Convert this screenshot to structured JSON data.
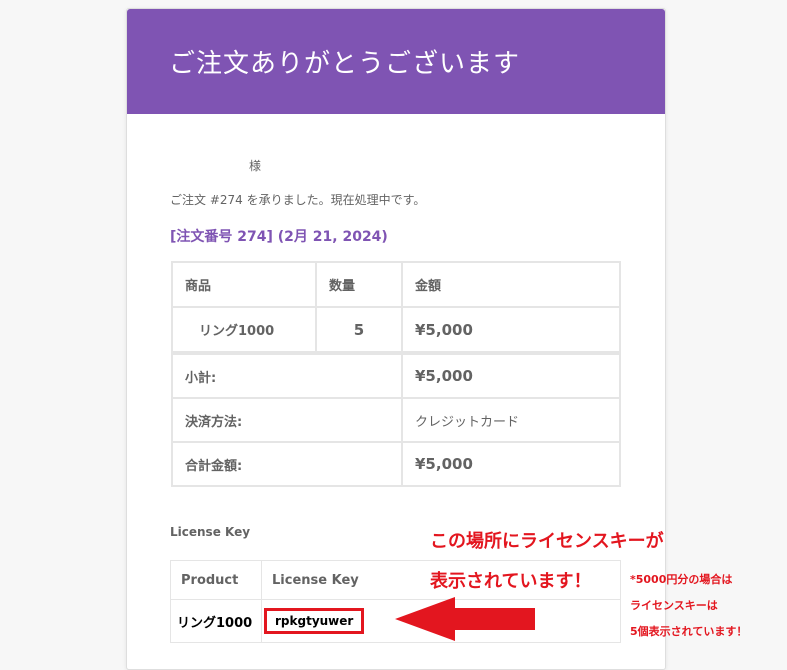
{
  "email": {
    "title": "ご注文ありがとうございます",
    "salutation": "様",
    "intro": "ご注文 #274 を承りました。現在処理中です。",
    "order_heading": "[注文番号 274] (2月 21, 2024)",
    "brand_color": "#7f54b3"
  },
  "order_table": {
    "headers": [
      "商品",
      "数量",
      "金額"
    ],
    "item": {
      "name": "リング1000",
      "qty": "5",
      "price": "¥5,000"
    },
    "totals": [
      {
        "label": "小計:",
        "value": "¥5,000"
      },
      {
        "label": "決済方法:",
        "value": "クレジットカード"
      },
      {
        "label": "合計金額:",
        "value": "¥5,000"
      }
    ]
  },
  "license": {
    "section_title": "License Key",
    "headers": [
      "Product",
      "License Key"
    ],
    "row": {
      "product": "リング1000",
      "key": "rpkgtyuwer"
    }
  },
  "annotation": {
    "line1": "この場所にライセンスキーが",
    "line2": "表示されています！",
    "note1": "*5000円分の場合は",
    "note2": "ライセンスキーは",
    "note3": "5個表示されています！",
    "color": "#e3161f",
    "icon": "left-arrow-icon"
  }
}
